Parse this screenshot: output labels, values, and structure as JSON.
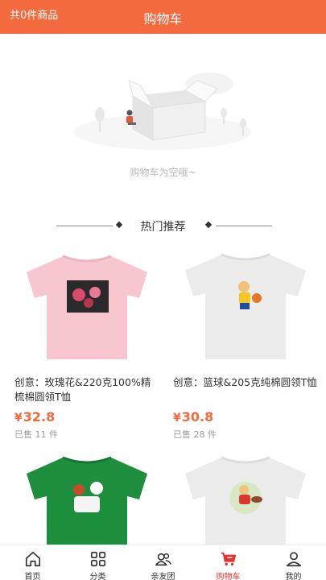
{
  "header": {
    "count_text": "共0件商品",
    "title": "购物车"
  },
  "empty_state": {
    "text": "购物车为空哦~"
  },
  "recommend": {
    "title": "热门推荐"
  },
  "products": [
    {
      "name": "创意：玫瑰花&220克100%精梳棉圆领T恤",
      "price": "32.8",
      "currency": "¥",
      "sold": "已售 11 件",
      "shirt_color": "#f7c6cf",
      "print": "rose"
    },
    {
      "name": "创意：篮球&205克纯棉圆领T恤",
      "price": "30.8",
      "currency": "¥",
      "sold": "已售 28 件",
      "shirt_color": "#ebebeb",
      "print": "basketball"
    },
    {
      "name": "",
      "price": "",
      "currency": "",
      "sold": "",
      "shirt_color": "#1d8f3c",
      "print": "soccer"
    },
    {
      "name": "",
      "price": "",
      "currency": "",
      "sold": "",
      "shirt_color": "#ebebeb",
      "print": "rugby"
    }
  ],
  "tabbar": {
    "items": [
      {
        "label": "首页",
        "icon": "home-icon"
      },
      {
        "label": "分类",
        "icon": "grid-icon"
      },
      {
        "label": "亲友团",
        "icon": "group-icon"
      },
      {
        "label": "购物车",
        "icon": "cart-icon",
        "active": true
      },
      {
        "label": "我的",
        "icon": "user-icon"
      }
    ]
  },
  "colors": {
    "brand": "#f26a3d",
    "active_tab": "#e8312f"
  }
}
